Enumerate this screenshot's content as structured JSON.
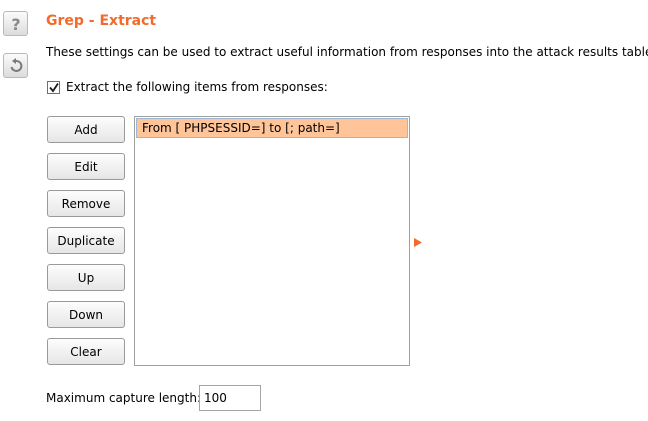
{
  "header": {
    "title": "Grep - Extract",
    "description": "These settings can be used to extract useful information from responses into the attack results table.",
    "title_color": "#f26b2c"
  },
  "side_icons": {
    "help": "help-icon",
    "reset": "reset-icon"
  },
  "extract": {
    "checkbox_label": "Extract the following items from responses:",
    "checked": true
  },
  "buttons": {
    "add": "Add",
    "edit": "Edit",
    "remove": "Remove",
    "duplicate": "Duplicate",
    "up": "Up",
    "down": "Down",
    "clear": "Clear"
  },
  "items": [
    {
      "label": "From [ PHPSESSID=] to [; path=]",
      "selected": true
    }
  ],
  "selection_color": "#ffc599",
  "max_capture": {
    "label": "Maximum capture length:",
    "value": "100"
  }
}
